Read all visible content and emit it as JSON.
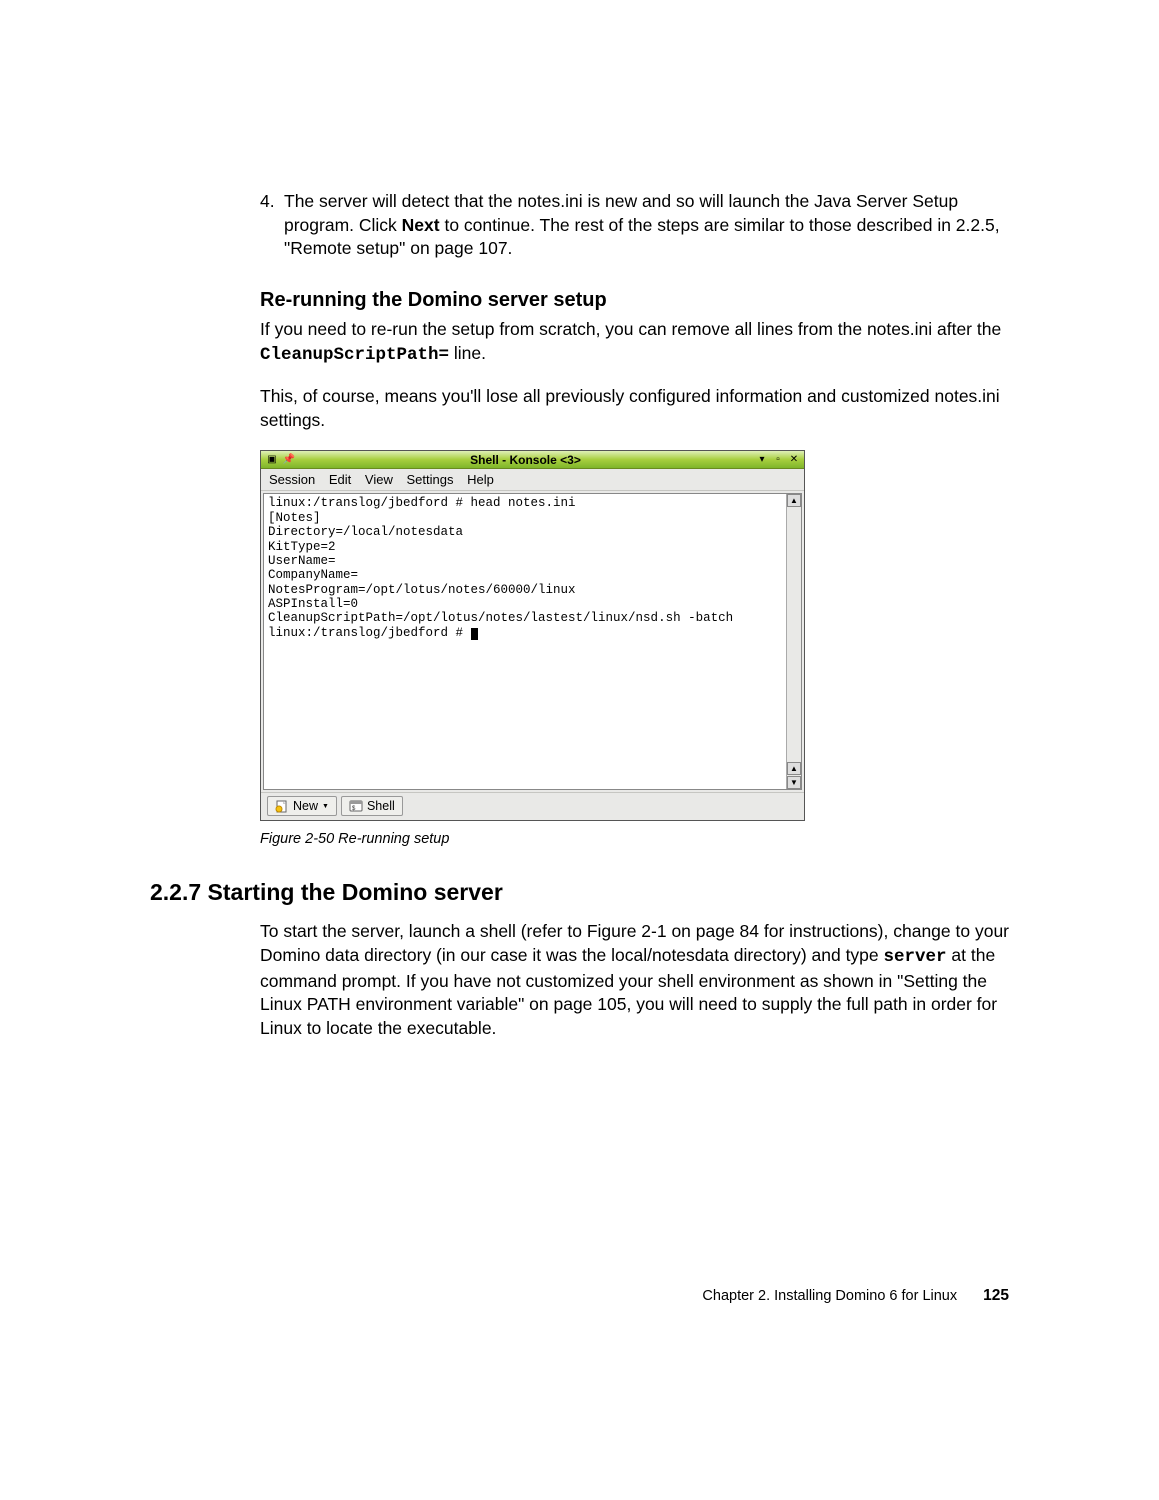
{
  "step4": {
    "number": "4.",
    "before_bold": "The server will detect that the notes.ini is new and so will launch the Java Server Setup program. Click ",
    "bold": "Next",
    "after_bold": " to continue. The rest of the steps are similar to those described in 2.2.5, \"Remote setup\" on page 107."
  },
  "heading_rerun": "Re-running the Domino server setup",
  "rerun_para": {
    "before_code": "If you need to re-run the setup from scratch, you can remove all lines from the notes.ini after the ",
    "code": "CleanupScriptPath=",
    "after_code": " line."
  },
  "rerun_para2": "This, of course, means you'll lose all previously configured information and customized notes.ini settings.",
  "konsole": {
    "title": "Shell - Konsole <3>",
    "menus": [
      "Session",
      "Edit",
      "View",
      "Settings",
      "Help"
    ],
    "terminal": "linux:/translog/jbedford # head notes.ini\n[Notes]\nDirectory=/local/notesdata\nKitType=2\nUserName=\nCompanyName=\nNotesProgram=/opt/lotus/notes/60000/linux\nASPInstall=0\nCleanupScriptPath=/opt/lotus/notes/lastest/linux/nsd.sh -batch\nlinux:/translog/jbedford # ",
    "tabs": [
      {
        "label": "New"
      },
      {
        "label": "Shell"
      }
    ]
  },
  "figure_caption": "Figure 2-50   Re-running setup",
  "section_heading": "2.2.7  Starting the Domino server",
  "section_para": {
    "p1": "To start the server, launch a shell (refer to Figure 2-1 on page 84 for instructions), change to your Domino data directory (in our case it was the local/notesdata directory) and type ",
    "code": "server",
    "p2": " at the command prompt. If you have not customized your shell environment as shown in \"Setting the Linux PATH environment variable\" on page 105, you will need to supply the full path in order for Linux to locate the executable."
  },
  "footer": {
    "chapter": "Chapter 2. Installing Domino 6 for Linux",
    "page": "125"
  }
}
